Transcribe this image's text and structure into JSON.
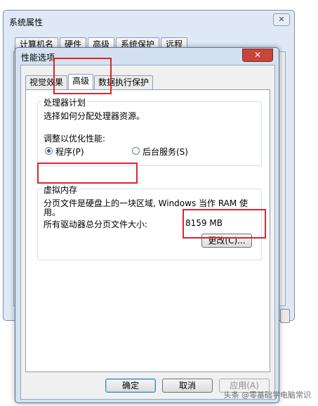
{
  "system_window": {
    "title": "系统属性",
    "close_glyph": "✕",
    "tabs": [
      "计算机名",
      "硬件",
      "高级",
      "系统保护",
      "远程"
    ]
  },
  "perf_dialog": {
    "title": "性能选项",
    "close_glyph": "✕",
    "tabs": {
      "visual": "视觉效果",
      "advanced": "高级",
      "dep": "数据执行保护"
    },
    "processor": {
      "group_title": "处理器计划",
      "description": "选择如何分配处理器资源。",
      "adjust_label": "调整以优化性能:",
      "option_programs": "程序(P)",
      "option_background": "后台服务(S)",
      "selected": "程序(P)"
    },
    "virtual_memory": {
      "group_title": "虚拟内存",
      "description_line1": "分页文件是硬盘上的一块区域, Windows 当作 RAM 使",
      "description_line2": "用。",
      "total_label": "所有驱动器总分页文件大小:",
      "total_value": "8159 MB",
      "change_button": "更改(C)..."
    },
    "buttons": {
      "ok": "确定",
      "cancel": "取消",
      "apply": "应用(A)"
    }
  },
  "watermark": "头条 @零基础学电脑常识"
}
